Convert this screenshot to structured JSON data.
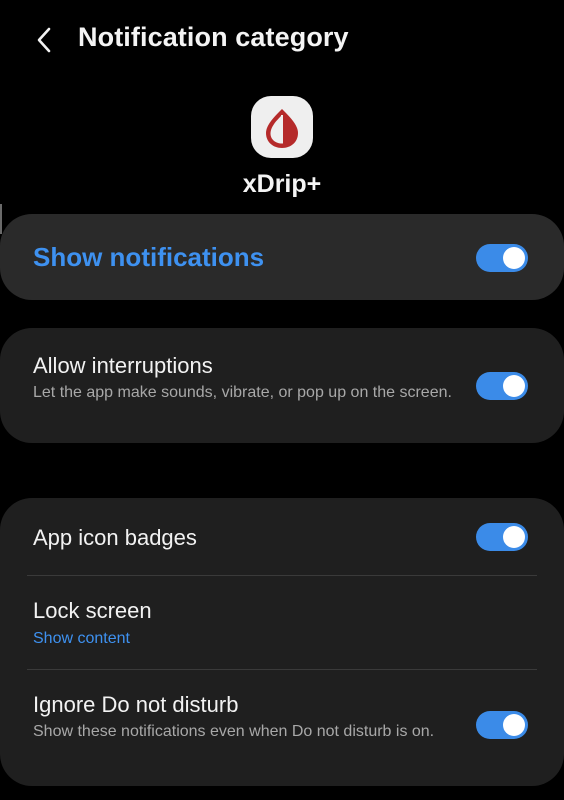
{
  "header": {
    "title": "Notification category",
    "back_icon": "chevron-left-icon"
  },
  "app": {
    "name": "xDrip+",
    "icon": "blood-drop-icon",
    "icon_color": "#b52a2a"
  },
  "colors": {
    "accent": "#3e91f0",
    "toggle_on": "#3b8be8",
    "background": "#000000",
    "card": "#1f1f1f"
  },
  "settings": {
    "show_notifications": {
      "label": "Show notifications",
      "enabled": true
    },
    "allow_interruptions": {
      "label": "Allow interruptions",
      "description": "Let the app make sounds, vibrate, or pop up on the screen.",
      "enabled": true
    },
    "app_icon_badges": {
      "label": "App icon badges",
      "enabled": true
    },
    "lock_screen": {
      "label": "Lock screen",
      "value": "Show content"
    },
    "ignore_dnd": {
      "label": "Ignore Do not disturb",
      "description": "Show these notifications even when Do not disturb is on.",
      "enabled": true
    }
  }
}
